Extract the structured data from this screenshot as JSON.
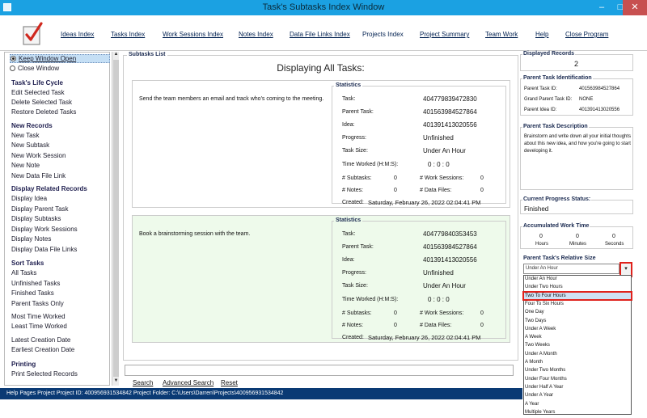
{
  "window": {
    "title": "Task's Subtasks Index Window",
    "minimize_glyph": "–",
    "maximize_glyph": "□",
    "close_glyph": "✕"
  },
  "menu": {
    "ideas": "Ideas Index",
    "tasks": "Tasks Index",
    "work_sessions": "Work Sessions Index",
    "notes": "Notes Index",
    "data_files": "Data File Links Index",
    "projects": "Projects Index",
    "project_summary": "Project Summary",
    "team_work": "Team Work",
    "help": "Help",
    "close": "Close Program"
  },
  "sidebar": {
    "keep_open": "Keep Window Open",
    "close_window": "Close Window",
    "life_cycle_header": "Task's Life Cycle",
    "edit": "Edit Selected Task",
    "delete": "Delete Selected Task",
    "restore": "Restore Deleted Tasks",
    "new_records_header": "New Records",
    "new_task": "New Task",
    "new_subtask": "New Subtask",
    "new_work_session": "New Work Session",
    "new_note": "New Note",
    "new_data_file_link": "New Data File Link",
    "display_related_header": "Display Related Records",
    "display_idea": "Display Idea",
    "display_parent_task": "Display Parent Task",
    "display_subtasks": "Display Subtasks",
    "display_work_sessions": "Display Work Sessions",
    "display_notes": "Display Notes",
    "display_data_file_links": "Display Data File Links",
    "sort_header": "Sort Tasks",
    "all_tasks": "All Tasks",
    "unfinished_tasks": "Unfinished Tasks",
    "finished_tasks": "Finished Tasks",
    "parent_tasks_only": "Parent Tasks Only",
    "most_time": "Most Time Worked",
    "least_time": "Least Time Worked",
    "latest_creation": "Latest Creation Date",
    "earliest_creation": "Earliest Creation Date",
    "printing_header": "Printing",
    "print_selected": "Print Selected Records"
  },
  "subtasks": {
    "group_label": "Subtasks List",
    "heading": "Displaying All Tasks:",
    "labels": {
      "statistics": "Statistics",
      "task": "Task:",
      "parent_task": "Parent Task:",
      "idea": "Idea:",
      "progress": "Progress:",
      "task_size": "Task Size:",
      "time_worked": "Time Worked (H:M:S):",
      "subtasks": "# Subtasks:",
      "work_sessions": "# Work Sessions:",
      "notes": "# Notes:",
      "data_files": "# Data Files:",
      "created": "Created:"
    },
    "cards": [
      {
        "description": "Send the team members an email and track who's coming to the meeting.",
        "task_id": "404779839472830",
        "parent_task_id": "401563984527864",
        "idea_id": "401391413020556",
        "progress": "Unfinished",
        "task_size": "Under An Hour",
        "time_worked": "0  :  0  :  0",
        "subtasks": "0",
        "work_sessions": "0",
        "notes": "0",
        "data_files": "0",
        "created": "Saturday, February 26, 2022  02:04:41 PM"
      },
      {
        "description": "Book a brainstorming session with the team.",
        "task_id": "404779840353453",
        "parent_task_id": "401563984527864",
        "idea_id": "401391413020556",
        "progress": "Unfinished",
        "task_size": "Under An Hour",
        "time_worked": "0  :  0  :  0",
        "subtasks": "0",
        "work_sessions": "0",
        "notes": "0",
        "data_files": "0",
        "created": "Saturday, February 26, 2022  02:04:41 PM"
      }
    ],
    "search": "Search",
    "advanced_search": "Advanced Search",
    "reset": "Reset"
  },
  "right": {
    "displayed_label": "Displayed Records",
    "displayed_count": "2",
    "parent_id_label": "Parent Task Identification",
    "parent_task_id_label": "Parent Task ID:",
    "parent_task_id": "401563984527864",
    "grand_parent_label": "Grand Parent Task ID:",
    "grand_parent_id": "NONE",
    "parent_idea_label": "Parent Idea ID:",
    "parent_idea_id": "401391413020556",
    "description_label": "Parent Task Description",
    "description": "Brainstorm and write down all your initial thoughts about this new idea, and how you're going to start developing it.",
    "progress_label": "Current Progress Status:",
    "progress_value": "Finished",
    "accum_label": "Accumulated Work Time",
    "hours_val": "0",
    "minutes_val": "0",
    "seconds_val": "0",
    "hours_label": "Hours",
    "minutes_label": "Minutes",
    "seconds_label": "Seconds",
    "relative_size_label": "Parent Task's Relative Size",
    "combo_value": "Under An Hour",
    "combo_glyph": "▾",
    "options": [
      "Under An Hour",
      "Under Two Hours",
      "Two To Four Hours",
      "Four To Six Hours",
      "One Day",
      "Two Days",
      "Under A Week",
      "A Week",
      "Two Weeks",
      "Under A Month",
      "A Month",
      "Under Two Months",
      "Under Four Months",
      "Under Half A Year",
      "Under A Year",
      "A Year",
      "Multiple Years"
    ],
    "highlighted_option": "Two To Four Hours"
  },
  "status": {
    "text": "Help Pages Project    Project ID: 400956931534842    Project Folder: C:\\Users\\Darren\\Projects\\400956931534842"
  },
  "colors": {
    "title_bar": "#1ba1e2",
    "close_button": "#c75050",
    "status_bar": "#0a3a74",
    "card_highlight": "#eefaeb",
    "selection_outline": "#e0221c"
  }
}
